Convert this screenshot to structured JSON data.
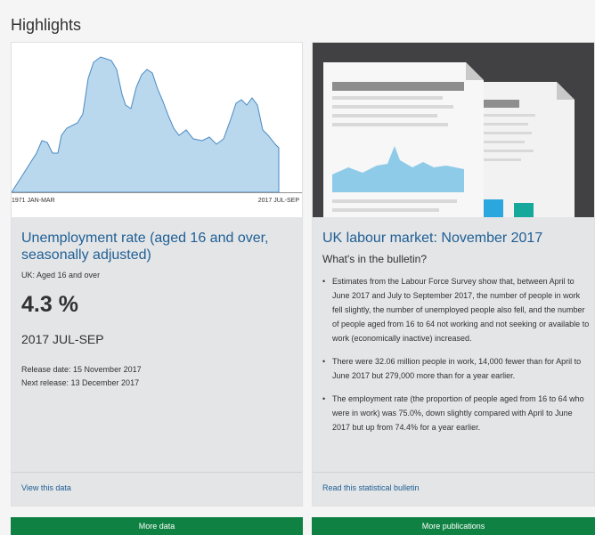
{
  "page": {
    "section_title": "Highlights"
  },
  "data_card": {
    "chart": {
      "axis_start": "1971 JAN-MAR",
      "axis_end": "2017 JUL-SEP"
    },
    "title": "Unemployment rate (aged 16 and over, seasonally adjusted)",
    "subtitle": "UK: Aged 16 and over",
    "value": "4.3 %",
    "period": "2017 JUL-SEP",
    "release_date": "Release date: 15 November 2017",
    "next_release": "Next release: 13 December 2017",
    "link": "View this data",
    "button": "More data"
  },
  "publication_card": {
    "title": "UK labour market: November 2017",
    "subheading": "What's in the bulletin?",
    "bullets": [
      "Estimates from the Labour Force Survey show that, between April to June 2017 and July to September 2017, the number of people in work fell slightly, the number of unemployed people also fell, and the number of people aged from 16 to 64 not working and not seeking or available to work (economically inactive) increased.",
      "There were 32.06 million people in work, 14,000 fewer than for April to June 2017 but 279,000 more than for a year earlier.",
      "The employment rate (the proportion of people aged from 16 to 64 who were in work) was 75.0%, down slightly compared with April to June 2017 but up from 74.4% for a year earlier."
    ],
    "link": "Read this statistical bulletin",
    "button": "More publications"
  },
  "colors": {
    "link_blue": "#206095",
    "button_green": "#0f8243",
    "sparkline_fill": "#b9d8ee",
    "sparkline_stroke": "#4a8ac2"
  }
}
